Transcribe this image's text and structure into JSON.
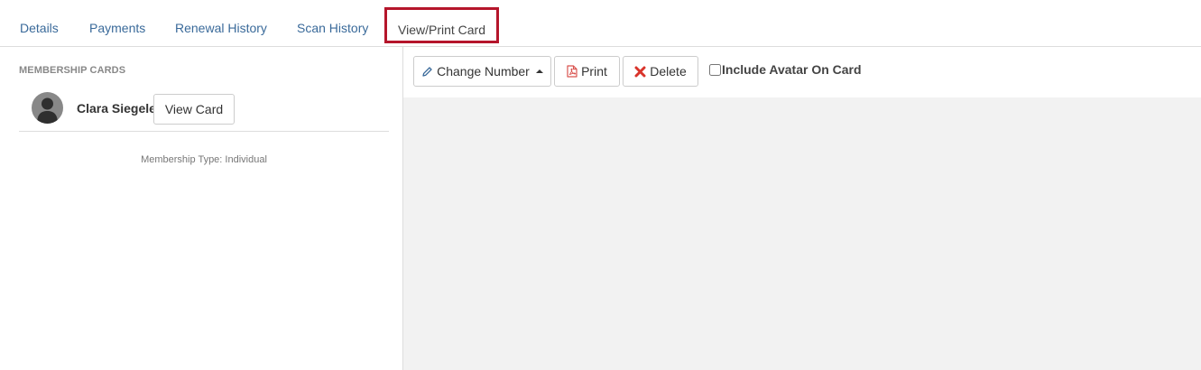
{
  "tabs": [
    {
      "label": "Details"
    },
    {
      "label": "Payments"
    },
    {
      "label": "Renewal History"
    },
    {
      "label": "Scan History"
    },
    {
      "label": "View/Print Card",
      "active": true
    }
  ],
  "left_panel": {
    "section_title": "MEMBERSHIP CARDS",
    "member": {
      "name": "Clara Siegele",
      "avatar_icon": "user-silhouette-icon"
    },
    "view_card_label": "View Card",
    "membership_type": "Membership Type: Individual"
  },
  "toolbar": {
    "change_number_label": "Change Number",
    "change_number_icon": "pencil-icon",
    "print_label": "Print",
    "print_icon": "pdf-file-icon",
    "delete_label": "Delete",
    "delete_icon": "x-icon",
    "include_avatar_label": "Include Avatar On Card",
    "include_avatar_checked": false
  },
  "colors": {
    "accent_tab_border": "#b5152b",
    "link": "#3a6a9a",
    "delete_icon": "#d9342b",
    "print_icon": "#d9534f",
    "pencil_icon": "#3a6a9a",
    "preview_bg": "#f2f2f2"
  }
}
